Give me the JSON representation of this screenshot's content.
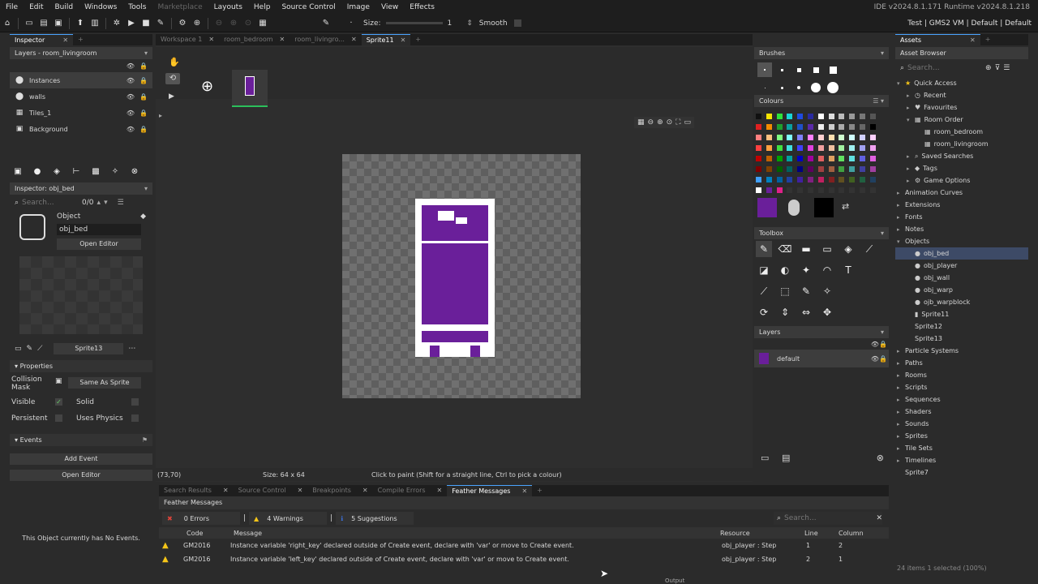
{
  "menu": [
    "File",
    "Edit",
    "Build",
    "Windows",
    "Tools",
    "Marketplace",
    "Layouts",
    "Help",
    "Source Control",
    "Image",
    "View",
    "Effects"
  ],
  "version": "IDE v2024.8.1.171  Runtime v2024.8.1.218",
  "targets": "Test  |  GMS2 VM  |  Default  |  Default",
  "size_label": "Size:",
  "size_value": "1",
  "smooth_label": "Smooth",
  "inspector": {
    "tab": "Inspector",
    "layers_title": "Layers - room_livingroom",
    "layers": [
      "Instances",
      "walls",
      "Tiles_1",
      "Background"
    ],
    "obj_title": "Inspector: obj_bed",
    "search_placeholder": "Search...",
    "search_count": "0/0",
    "object_label": "Object",
    "object_name": "obj_bed",
    "open_editor": "Open Editor",
    "sprite_name": "Sprite13",
    "properties": "Properties",
    "collision_mask": "Collision Mask",
    "same_as_sprite": "Same As Sprite",
    "visible": "Visible",
    "solid": "Solid",
    "persistent": "Persistent",
    "uses_physics": "Uses Physics",
    "events": "Events",
    "add_event": "Add Event",
    "open_editor2": "Open Editor",
    "no_events": "This Object currently has No Events."
  },
  "doc_tabs": [
    "Workspace 1",
    "room_bedroom",
    "room_livingro...",
    "Sprite11"
  ],
  "canvas": {
    "coords": "(73,70)",
    "size": "Size: 64 x 64",
    "hint": "Click to paint (Shift for a straight line, Ctrl to pick a colour)"
  },
  "right": {
    "brushes": "Brushes",
    "colours": "Colours",
    "toolbox": "Toolbox",
    "layers": "Layers",
    "layer_default": "default"
  },
  "assets": {
    "tab": "Assets",
    "title": "Asset Browser",
    "search_placeholder": "Search...",
    "items": [
      {
        "label": "Quick Access",
        "lvl": 0,
        "ar": "▾",
        "ic": "★"
      },
      {
        "label": "Recent",
        "lvl": 1,
        "ar": "▸",
        "ic": "◷"
      },
      {
        "label": "Favourites",
        "lvl": 1,
        "ar": "▸",
        "ic": "♥"
      },
      {
        "label": "Room Order",
        "lvl": 1,
        "ar": "▾",
        "ic": "▦"
      },
      {
        "label": "room_bedroom",
        "lvl": 2,
        "ar": "",
        "ic": "▦"
      },
      {
        "label": "room_livingroom",
        "lvl": 2,
        "ar": "",
        "ic": "▦"
      },
      {
        "label": "Saved Searches",
        "lvl": 1,
        "ar": "▸",
        "ic": "⌕"
      },
      {
        "label": "Tags",
        "lvl": 1,
        "ar": "▸",
        "ic": "◆"
      },
      {
        "label": "Game Options",
        "lvl": 1,
        "ar": "▸",
        "ic": "⚙"
      },
      {
        "label": "Animation Curves",
        "lvl": 0,
        "ar": "▸",
        "ic": ""
      },
      {
        "label": "Extensions",
        "lvl": 0,
        "ar": "▸",
        "ic": ""
      },
      {
        "label": "Fonts",
        "lvl": 0,
        "ar": "▸",
        "ic": ""
      },
      {
        "label": "Notes",
        "lvl": 0,
        "ar": "▸",
        "ic": ""
      },
      {
        "label": "Objects",
        "lvl": 0,
        "ar": "▾",
        "ic": ""
      },
      {
        "label": "obj_bed",
        "lvl": 1,
        "ar": "",
        "ic": "●",
        "sel": true
      },
      {
        "label": "obj_player",
        "lvl": 1,
        "ar": "",
        "ic": "●"
      },
      {
        "label": "obj_wall",
        "lvl": 1,
        "ar": "",
        "ic": "●"
      },
      {
        "label": "obj_warp",
        "lvl": 1,
        "ar": "",
        "ic": "●"
      },
      {
        "label": "ojb_warpblock",
        "lvl": 1,
        "ar": "",
        "ic": "●"
      },
      {
        "label": "Sprite11",
        "lvl": 1,
        "ar": "",
        "ic": "▮"
      },
      {
        "label": "Sprite12",
        "lvl": 1,
        "ar": "",
        "ic": ""
      },
      {
        "label": "Sprite13",
        "lvl": 1,
        "ar": "",
        "ic": ""
      },
      {
        "label": "Particle Systems",
        "lvl": 0,
        "ar": "▸",
        "ic": ""
      },
      {
        "label": "Paths",
        "lvl": 0,
        "ar": "▸",
        "ic": ""
      },
      {
        "label": "Rooms",
        "lvl": 0,
        "ar": "▸",
        "ic": ""
      },
      {
        "label": "Scripts",
        "lvl": 0,
        "ar": "▸",
        "ic": ""
      },
      {
        "label": "Sequences",
        "lvl": 0,
        "ar": "▸",
        "ic": ""
      },
      {
        "label": "Shaders",
        "lvl": 0,
        "ar": "▸",
        "ic": ""
      },
      {
        "label": "Sounds",
        "lvl": 0,
        "ar": "▸",
        "ic": ""
      },
      {
        "label": "Sprites",
        "lvl": 0,
        "ar": "▸",
        "ic": ""
      },
      {
        "label": "Tile Sets",
        "lvl": 0,
        "ar": "▸",
        "ic": ""
      },
      {
        "label": "Timelines",
        "lvl": 0,
        "ar": "▸",
        "ic": ""
      },
      {
        "label": "Sprite7",
        "lvl": 0,
        "ar": "",
        "ic": ""
      }
    ],
    "footer": "24 items     1 selected (100%)"
  },
  "output_tabs": [
    "Search Results",
    "Source Control",
    "Breakpoints",
    "Compile Errors",
    "Feather Messages"
  ],
  "feather": {
    "title": "Feather Messages",
    "errors": "0 Errors",
    "warnings": "4 Warnings",
    "suggestions": "5 Suggestions",
    "search_placeholder": "Search...",
    "cols": [
      "Code",
      "Message",
      "Resource",
      "Line",
      "Column"
    ],
    "rows": [
      {
        "code": "GM2016",
        "msg": "Instance variable 'right_key' declared outside of Create event, declare with 'var' or move to Create event.",
        "res": "obj_player : Step",
        "line": "1",
        "col": "2"
      },
      {
        "code": "GM2016",
        "msg": "Instance variable 'left_key' declared outside of Create event, declare with 'var' or move to Create event.",
        "res": "obj_player : Step",
        "line": "2",
        "col": "1"
      }
    ]
  },
  "output_label": "Output",
  "colors": {
    "accent": "#4aa3ff",
    "purple": "#6a1f9a",
    "warn": "#f5c518",
    "error": "#e0443a",
    "info": "#3a6fd8"
  }
}
